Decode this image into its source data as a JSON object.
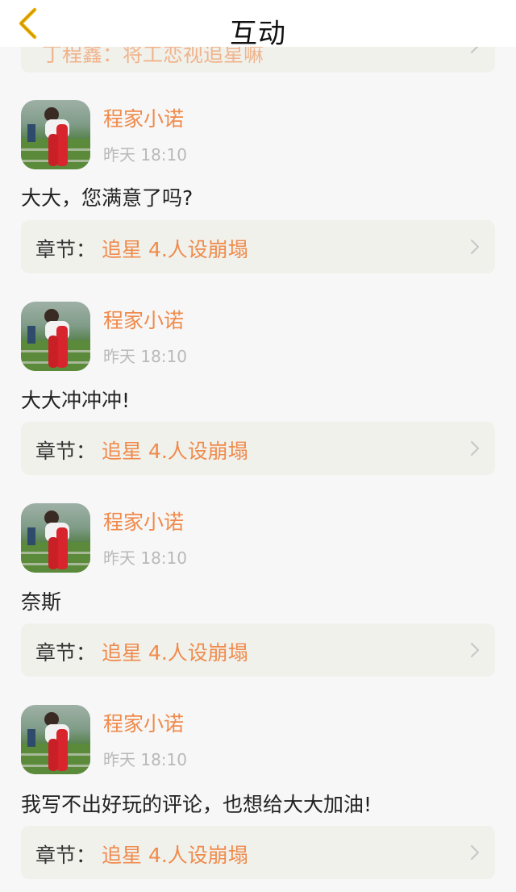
{
  "header": {
    "title": "互动"
  },
  "top_card": {
    "text": "丁程鑫：将工恋视追星嘛"
  },
  "comments": [
    {
      "username": "程家小诺",
      "time": "昨天 18:10",
      "text": "大大，您满意了吗?",
      "chapter_label": "章节：",
      "chapter_name": "追星 4.人设崩塌"
    },
    {
      "username": "程家小诺",
      "time": "昨天 18:10",
      "text": "大大冲冲冲!",
      "chapter_label": "章节：",
      "chapter_name": "追星 4.人设崩塌"
    },
    {
      "username": "程家小诺",
      "time": "昨天 18:10",
      "text": "奈斯",
      "chapter_label": "章节：",
      "chapter_name": "追星 4.人设崩塌"
    },
    {
      "username": "程家小诺",
      "time": "昨天 18:10",
      "text": "我写不出好玩的评论，也想给大大加油!",
      "chapter_label": "章节：",
      "chapter_name": "追星 4.人设崩塌"
    }
  ],
  "colors": {
    "accent": "#f08a4b",
    "back_icon": "#f3b400",
    "card_bg": "#f1f1ec",
    "timestamp": "#b9b9b9"
  }
}
